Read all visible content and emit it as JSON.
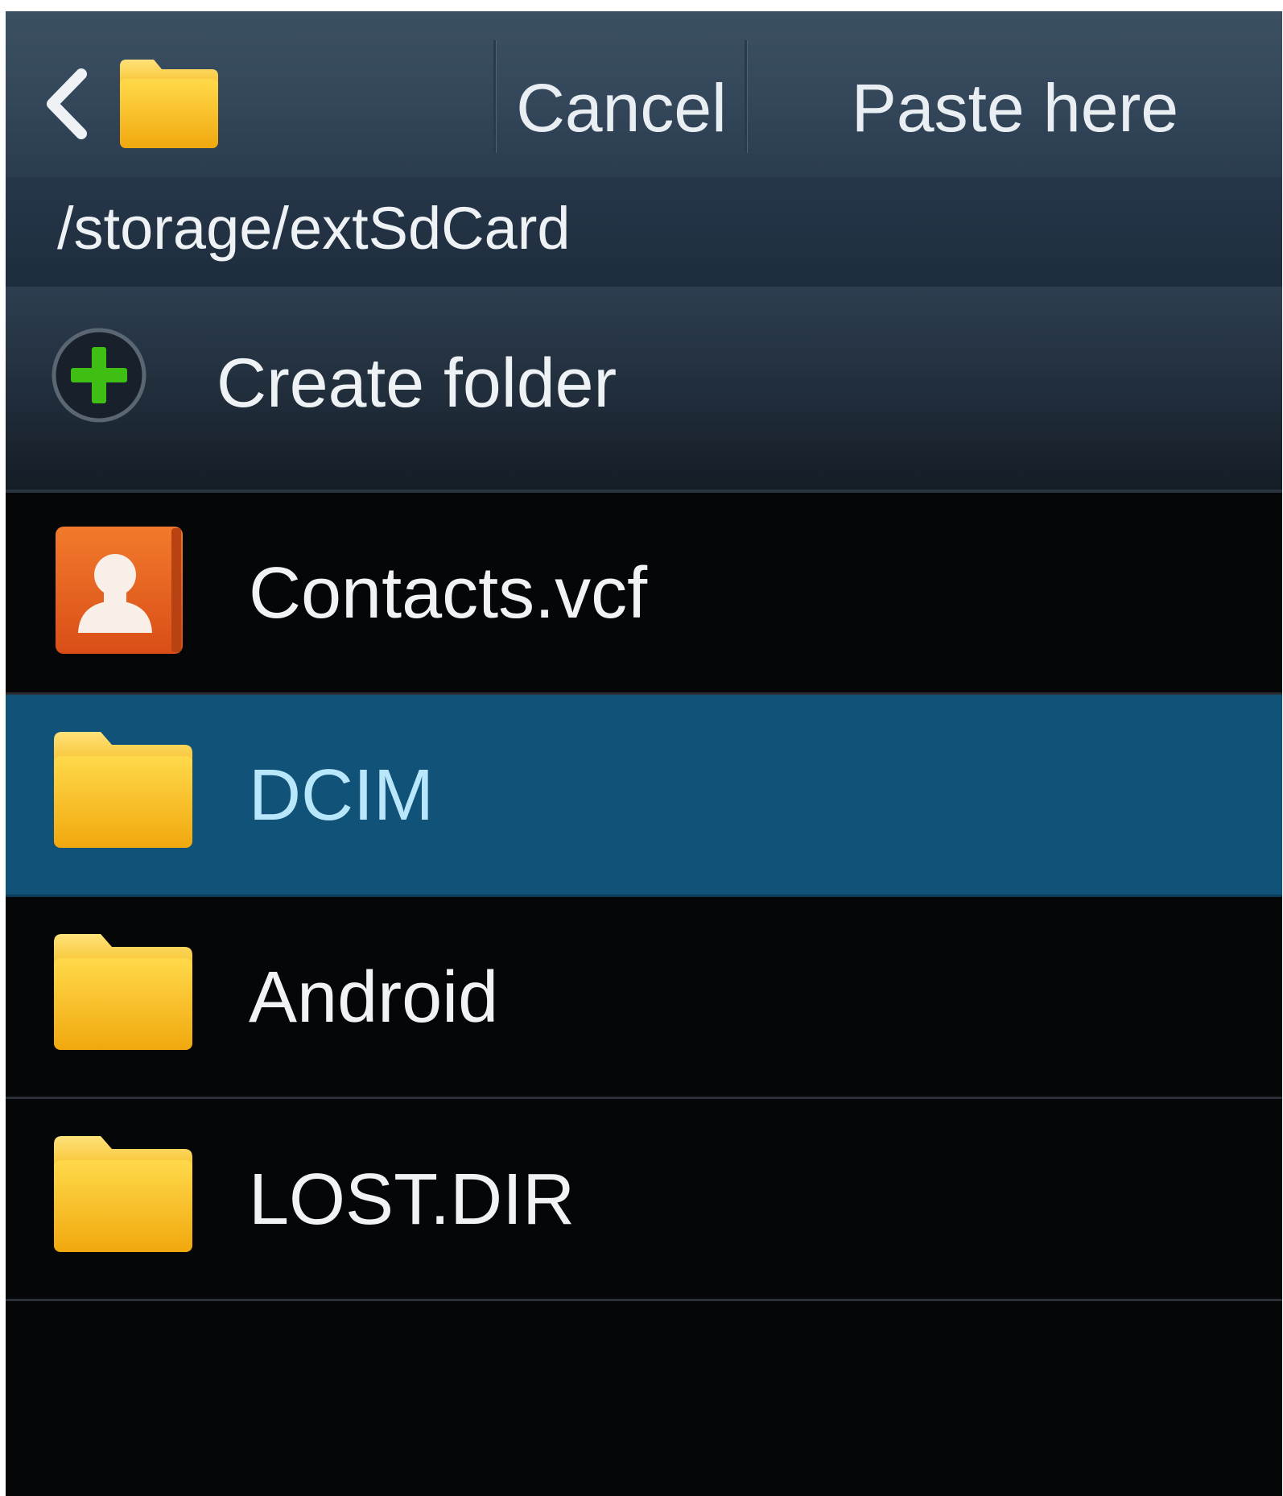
{
  "action_bar": {
    "back_icon": "chevron-left-icon",
    "folder_icon": "folder-icon",
    "cancel_label": "Cancel",
    "paste_label": "Paste here"
  },
  "path": "/storage/extSdCard",
  "create_folder": {
    "icon": "plus-circle-icon",
    "label": "Create folder"
  },
  "items": [
    {
      "name": "Contacts.vcf",
      "icon": "contact-card-icon",
      "selected": false
    },
    {
      "name": "DCIM",
      "icon": "folder-icon",
      "selected": true
    },
    {
      "name": "Android",
      "icon": "folder-icon",
      "selected": false
    },
    {
      "name": "LOST.DIR",
      "icon": "folder-icon",
      "selected": false
    }
  ],
  "colors": {
    "action_bar": "#33465a",
    "selected_row": "#105278",
    "folder": "#f5bd1f",
    "contact_icon": "#e0571c",
    "plus": "#3fbf14"
  }
}
